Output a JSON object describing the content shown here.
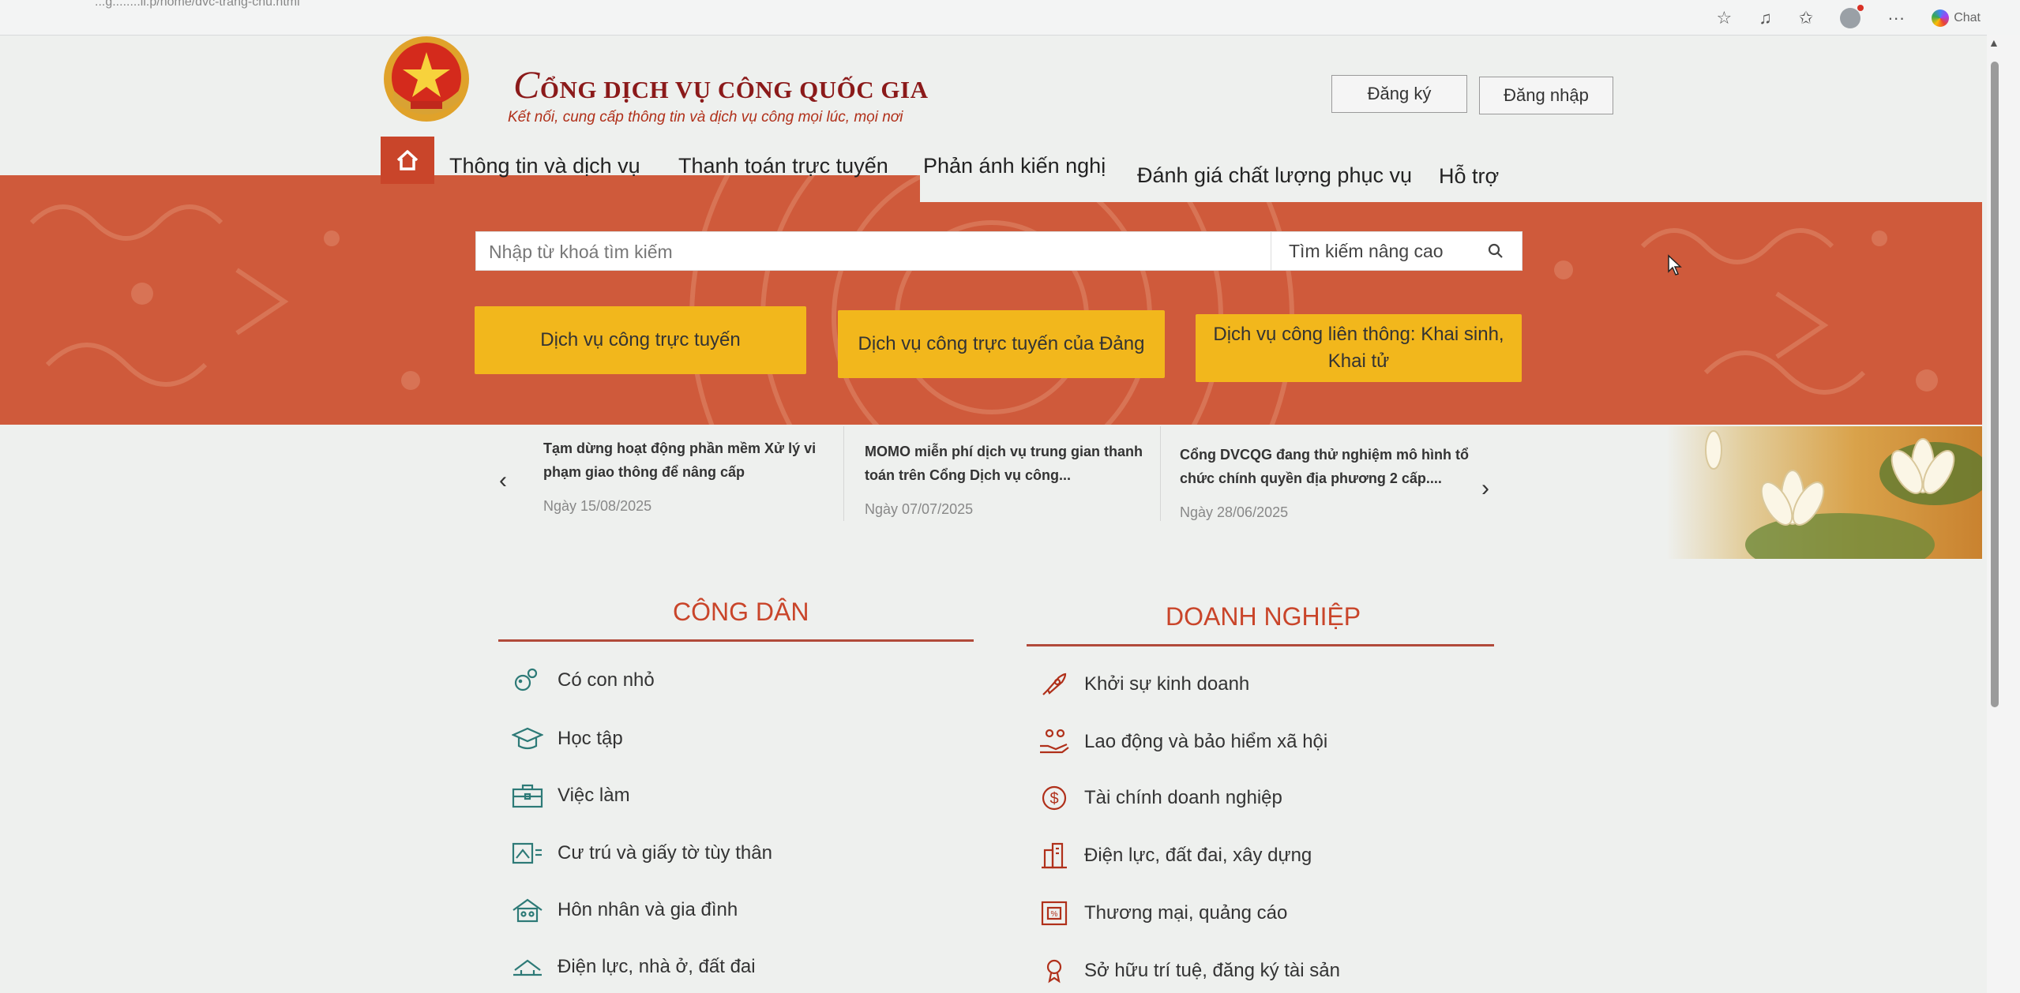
{
  "browser": {
    "url": "...g........ii.p/home/dvc-trang-chu.html",
    "chat_label": "Chat",
    "icons": [
      "star-icon",
      "reading-list-icon",
      "favorites-icon",
      "profile-icon",
      "more-icon",
      "copilot-icon"
    ]
  },
  "header": {
    "title_first_letter": "C",
    "title_rest": "ỔNG DỊCH VỤ CÔNG QUỐC GIA",
    "subtitle": "Kết nối, cung cấp thông tin và dịch vụ công mọi lúc, mọi nơi",
    "register_label": "Đăng ký",
    "login_label": "Đăng nhập"
  },
  "nav": {
    "items": [
      {
        "label": "Thông tin và dịch vụ"
      },
      {
        "label": "Thanh toán trực tuyến"
      },
      {
        "label": "Phản ánh kiến nghị"
      },
      {
        "label": "Đánh giá chất lượng phục vụ"
      },
      {
        "label": "Hỗ trợ"
      }
    ]
  },
  "search": {
    "placeholder": "Nhập từ khoá tìm kiếm",
    "advanced_label": "Tìm kiếm nâng cao"
  },
  "quick_buttons": [
    {
      "label": "Dịch vụ công trực tuyến"
    },
    {
      "label": "Dịch vụ công trực tuyến của Đảng"
    },
    {
      "label": "Dịch vụ công liên thông: Khai sinh, Khai tử"
    }
  ],
  "news": [
    {
      "title": "Tạm dừng hoạt động phần mềm Xử lý vi phạm giao thông để nâng cấp",
      "date": "Ngày 15/08/2025"
    },
    {
      "title": "MOMO miễn phí dịch vụ trung gian thanh toán trên Cổng Dịch vụ công...",
      "date": "Ngày 07/07/2025"
    },
    {
      "title": "Cổng DVCQG đang thử nghiệm mô hình tổ chức chính quyền địa phương 2 cấp....",
      "date": "Ngày 28/06/2025"
    }
  ],
  "citizen": {
    "heading": "CÔNG DÂN",
    "items": [
      {
        "label": "Có con nhỏ",
        "icon": "baby-icon"
      },
      {
        "label": "Học tập",
        "icon": "graduation-cap-icon"
      },
      {
        "label": "Việc làm",
        "icon": "briefcase-icon"
      },
      {
        "label": "Cư trú và giấy tờ tùy thân",
        "icon": "id-card-icon"
      },
      {
        "label": "Hôn nhân và gia đình",
        "icon": "family-home-icon"
      },
      {
        "label": "Điện lực, nhà ở, đất đai",
        "icon": "house-land-icon"
      }
    ]
  },
  "business": {
    "heading": "DOANH NGHIỆP",
    "items": [
      {
        "label": "Khởi sự kinh doanh",
        "icon": "rocket-icon"
      },
      {
        "label": "Lao động và bảo hiểm xã hội",
        "icon": "labor-insurance-icon"
      },
      {
        "label": "Tài chính doanh nghiệp",
        "icon": "dollar-icon"
      },
      {
        "label": "Điện lực, đất đai, xây dựng",
        "icon": "building-icon"
      },
      {
        "label": "Thương mại, quảng cáo",
        "icon": "commerce-icon"
      },
      {
        "label": "Sở hữu trí tuệ, đăng ký tài sản",
        "icon": "intellectual-property-icon"
      }
    ]
  },
  "colors": {
    "brand_red": "#c9452a",
    "hero_orange": "#cf5a3b",
    "button_yellow": "#f2b71c",
    "title_dark_red": "#8b1a1a"
  }
}
